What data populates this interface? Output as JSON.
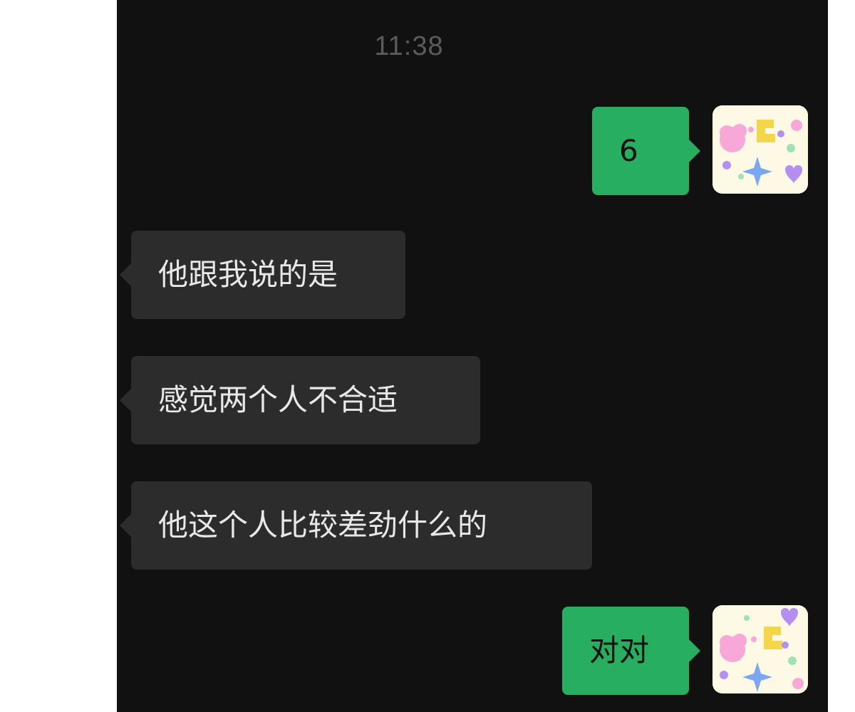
{
  "chat": {
    "timestamp": "11:38",
    "messages": [
      {
        "direction": "outgoing",
        "text": "6"
      },
      {
        "direction": "incoming",
        "text": "他跟我说的是"
      },
      {
        "direction": "incoming",
        "text": "感觉两个人不合适"
      },
      {
        "direction": "incoming",
        "text": "他这个人比较差劲什么的"
      },
      {
        "direction": "outgoing",
        "text": "对对"
      }
    ]
  },
  "colors": {
    "background": "#111111",
    "incoming_bubble": "#2c2c2c",
    "outgoing_bubble": "#27ae60",
    "incoming_text": "#e8e8e8",
    "outgoing_text": "#111111",
    "timestamp_text": "#5b5b5b"
  },
  "icons": {
    "self_avatar": "sticker-avatar-icon"
  }
}
